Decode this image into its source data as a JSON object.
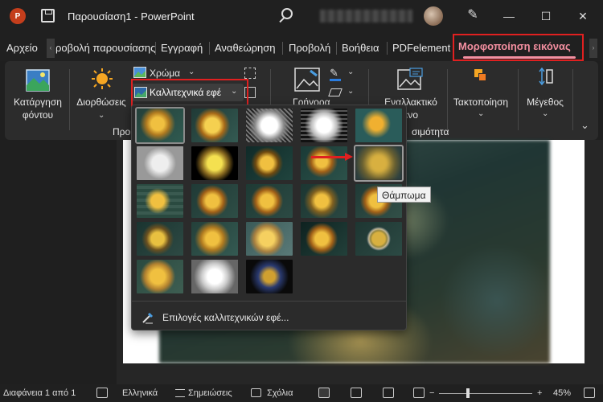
{
  "app": {
    "icon_letter": "P",
    "doc_title": "Παρουσίαση1  -  PowerPoint",
    "window_controls": {
      "minimize": "—",
      "maximize": "☐",
      "close": "✕"
    }
  },
  "tabs": {
    "items": [
      {
        "label": "Αρχείο"
      },
      {
        "label": "ροβολή παρουσίασης"
      },
      {
        "label": "Εγγραφή"
      },
      {
        "label": "Αναθεώρηση"
      },
      {
        "label": "Προβολή"
      },
      {
        "label": "Βοήθεια"
      },
      {
        "label": "PDFelement"
      }
    ],
    "active": "Μορφοποίηση εικόνας",
    "scroll_left": "‹",
    "scroll_right": "›"
  },
  "ribbon": {
    "remove_bg": {
      "line1": "Κατάργηση",
      "line2": "φόντου"
    },
    "corrections": {
      "label": "Διορθώσεις"
    },
    "color": {
      "label": "Χρώμα"
    },
    "artistic_effects": {
      "label": "Καλλιτεχνικά εφέ"
    },
    "group_label_partial": "Προ",
    "picture_styles_partial": "Γρήγορα",
    "alt_text": {
      "line1": "Εναλλακτικό",
      "line2": "ενο"
    },
    "accessibility_partial": "σιμότητα",
    "arrange": {
      "label": "Τακτοποίηση"
    },
    "size": {
      "label": "Μέγεθος"
    },
    "chevron": "⌄",
    "expand": "⌄"
  },
  "gallery": {
    "tooltip": "Θάμπωμα",
    "footer_option": "Επιλογές καλλιτεχνικών εφέ...",
    "selected_index": 0,
    "hovered_index": 9,
    "effects_count": 23
  },
  "status": {
    "slide_info": "Διαφάνεια 1 από 1",
    "language": "Ελληνικά",
    "notes": "Σημειώσεις",
    "comments": "Σχόλια",
    "zoom": "45%",
    "zoom_minus": "−",
    "zoom_plus": "+"
  },
  "colors": {
    "accent": "#f48fa0",
    "highlight": "#e02020",
    "brand": "#c43e1c"
  }
}
